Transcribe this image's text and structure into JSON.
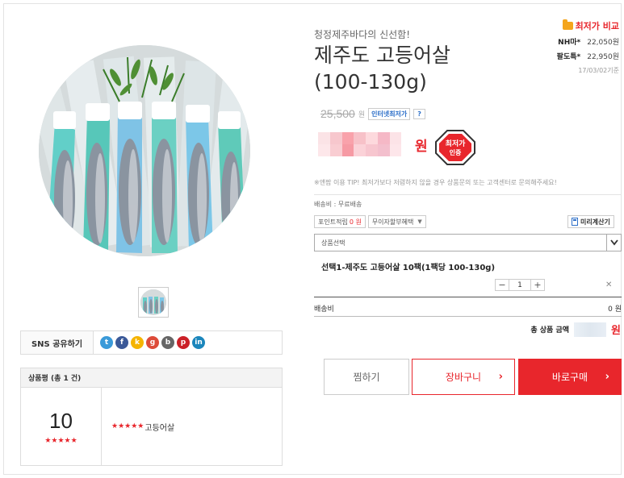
{
  "product": {
    "subtitle": "청정제주바다의 신선함!",
    "title_line1": "제주도 고등어살",
    "title_line2": "(100-130g)"
  },
  "compare": {
    "title": "최저가 비교",
    "rows": [
      {
        "shop": "NH마*",
        "price": "22,050원"
      },
      {
        "shop": "팔도특*",
        "price": "22,950원"
      }
    ],
    "date": "17/03/02기준"
  },
  "price": {
    "original": "25,500",
    "original_unit": "원",
    "internet_badge": "인터넷최저가",
    "help_badge": "?",
    "sale_unit": "원",
    "lowest_badge_line1": "최저가",
    "lowest_badge_line2": "인증"
  },
  "tip": "※앤팜 이용 TIP! 최저가보다 저렴하지 않을 경우 상품문의 또는 고객센터로 문의해주세요!",
  "shipping_info": "배송비 : 무료배송",
  "points": {
    "label": "포인트적립",
    "value": "0 원",
    "installment": "무이자할부혜택",
    "calculator": "미리계산기"
  },
  "select": {
    "placeholder": "상품선택"
  },
  "option": {
    "name": "선택1-제주도 고등어살 10팩(1팩당 100-130g)",
    "minus": "−",
    "qty": "1",
    "plus": "+",
    "remove": "✕"
  },
  "shipping_fee": {
    "label": "배송비",
    "value": "0 원"
  },
  "total": {
    "label": "총 상품 금액",
    "unit": "원"
  },
  "buttons": {
    "wish": "찜하기",
    "cart": "장바구니",
    "buy": "바로구매",
    "arrow": "›"
  },
  "sns": {
    "label": "SNS 공유하기",
    "icons": [
      {
        "name": "twitter-icon",
        "glyph": "t",
        "color": "#3a9ad9"
      },
      {
        "name": "facebook-icon",
        "glyph": "f",
        "color": "#3b5998"
      },
      {
        "name": "kakaostory-icon",
        "glyph": "k",
        "color": "#f5b400"
      },
      {
        "name": "googleplus-icon",
        "glyph": "g",
        "color": "#dd4b39"
      },
      {
        "name": "band-icon",
        "glyph": "b",
        "color": "#666666"
      },
      {
        "name": "pinterest-icon",
        "glyph": "p",
        "color": "#cb2027"
      },
      {
        "name": "linkedin-icon",
        "glyph": "in",
        "color": "#1b86bc"
      }
    ]
  },
  "review": {
    "header": "상품평 (총 1 건)",
    "score": "10",
    "score_stars": "★★★★★",
    "item_stars": "★★★★★",
    "item_text": "고등어살"
  },
  "colors": {
    "accent": "#e8262c",
    "link": "#2d6fc8"
  }
}
